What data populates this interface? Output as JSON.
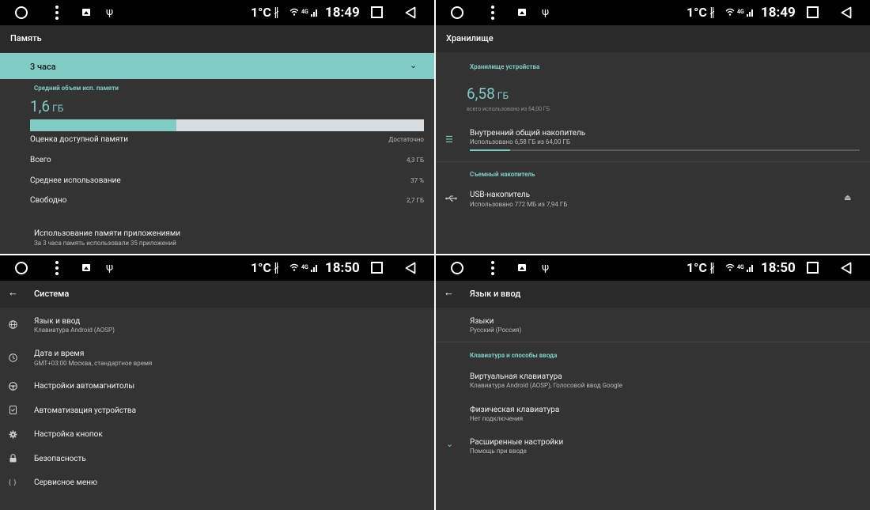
{
  "statusbar": {
    "temperature": "1°C",
    "network": "4G",
    "usb_glyph": "ψ",
    "bluetooth_glyph": "∦"
  },
  "panel1": {
    "title": "Память",
    "period": "3 часа",
    "chevron": "⌄",
    "avg_label": "Средний объем исп. памяти",
    "avg_value": "1,6",
    "avg_unit": "ГБ",
    "usage_fraction": 0.372,
    "rows": [
      {
        "label": "Оценка доступной памяти",
        "value": "Достаточно"
      },
      {
        "label": "Всего",
        "value": "4,3 ГБ"
      },
      {
        "label": "Среднее использование",
        "value": "37 %"
      },
      {
        "label": "Свободно",
        "value": "2,7 ГБ"
      }
    ],
    "apps_title": "Использование памяти приложениями",
    "apps_subtitle": "За 3 часа память использовали 35 приложений",
    "time": "18:49"
  },
  "panel2": {
    "title": "Хранилище",
    "device_section": "Хранилище устройства",
    "used_value": "6,58",
    "used_unit": "ГБ",
    "used_sub": "всего использовано из 64,00 ГБ",
    "internal_title": "Внутренний общий накопитель",
    "internal_sub": "Использовано 6,58 ГБ из 64,00 ГБ",
    "internal_fraction": 0.103,
    "removable_section": "Съемный накопитель",
    "usb_title": "USB-накопитель",
    "usb_sub": "Использовано 772 МБ из 7,94 ГБ",
    "eject_glyph": "⏏",
    "list_glyph": "☰",
    "time": "18:49"
  },
  "panel3": {
    "title": "Система",
    "back": "←",
    "items": [
      {
        "title": "Язык и ввод",
        "sub": "Клавиатура Android (AOSP)",
        "icon": "🌐"
      },
      {
        "title": "Дата и время",
        "sub": "GMT+03:00 Москва, стандартное время",
        "icon": "◷"
      },
      {
        "title": "Настройки автомагнитолы",
        "sub": "",
        "icon": "◍"
      },
      {
        "title": "Автоматизация устройства",
        "sub": "",
        "icon": "☑"
      },
      {
        "title": "Настройка кнопок",
        "sub": "",
        "icon": "⚙"
      },
      {
        "title": "Безопасность",
        "sub": "",
        "icon": "🔒"
      },
      {
        "title": "Сервисное меню",
        "sub": "",
        "icon": "{ }"
      }
    ],
    "time": "18:50"
  },
  "panel4": {
    "title": "Язык и ввод",
    "back": "←",
    "languages_title": "Языки",
    "languages_sub": "Русский (Россия)",
    "keyboards_section": "Клавиатура и способы ввода",
    "virtual_title": "Виртуальная клавиатура",
    "virtual_sub": "Клавиатура Android (AOSP), Голосовой ввод Google",
    "physical_title": "Физическая клавиатура",
    "physical_sub": "Нет подключения",
    "advanced_title": "Расширенные настройки",
    "advanced_sub": "Помощь при вводе",
    "expand_glyph": "⌄",
    "time": "18:50"
  },
  "colors": {
    "accent": "#80cbc4",
    "background": "#333333",
    "statusbar": "#000000"
  }
}
